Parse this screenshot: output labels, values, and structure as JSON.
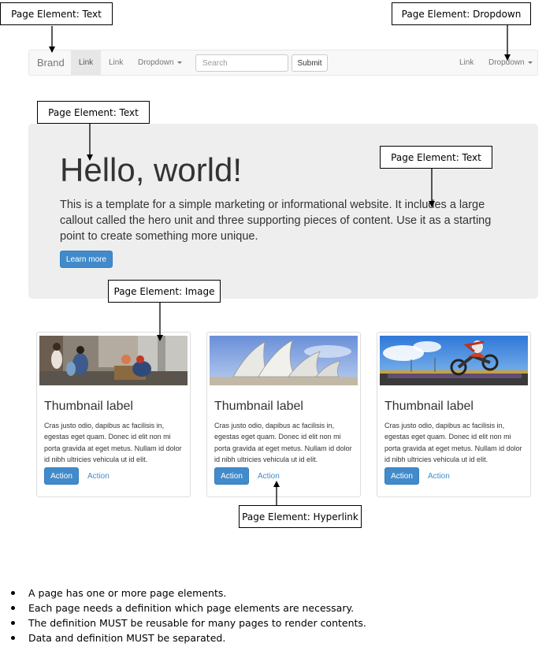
{
  "callouts": {
    "brand_text": "Page Element: Text",
    "dropdown": "Page Element: Dropdown",
    "hero_title": "Page Element: Text",
    "hero_text": "Page Element: Text",
    "image": "Page Element: Image",
    "hyperlink": "Page Element: Hyperlink"
  },
  "navbar": {
    "brand": "Brand",
    "links": [
      "Link",
      "Link"
    ],
    "dropdown": "Dropdown",
    "search_placeholder": "Search",
    "submit": "Submit",
    "right_link": "Link",
    "right_dropdown": "Dropdown"
  },
  "hero": {
    "title": "Hello, world!",
    "text": "This is a template for a simple marketing or informational website. It includes a large callout called the hero unit and three supporting pieces of content. Use it as a starting point to create something more unique.",
    "button": "Learn more"
  },
  "thumbnails": [
    {
      "image": "street-people-photo",
      "title": "Thumbnail label",
      "text": "Cras justo odio, dapibus ac facilisis in, egestas eget quam. Donec id elit non mi porta gravida at eget metus. Nullam id dolor id nibh ultricies vehicula ut id elit.",
      "button": "Action",
      "link": "Action"
    },
    {
      "image": "opera-house-photo",
      "title": "Thumbnail label",
      "text": "Cras justo odio, dapibus ac facilisis in, egestas eget quam. Donec id elit non mi porta gravida at eget metus. Nullam id dolor id nibh ultricies vehicula ut id elit.",
      "button": "Action",
      "link": "Action"
    },
    {
      "image": "motocross-photo",
      "title": "Thumbnail label",
      "text": "Cras justo odio, dapibus ac facilisis in, egestas eget quam. Donec id elit non mi porta gravida at eget metus. Nullam id dolor id nibh ultricies vehicula ut id elit.",
      "button": "Action",
      "link": "Action"
    }
  ],
  "bullets": [
    "A page has one or more page elements.",
    "Each page needs a definition which page elements are necessary.",
    "The definition MUST be reusable for many pages to render contents.",
    "Data and definition MUST be separated."
  ],
  "colors": {
    "primary": "#428bca",
    "link": "#428bca",
    "hero_bg": "#eeeeee",
    "navbar_bg": "#f8f8f8"
  }
}
